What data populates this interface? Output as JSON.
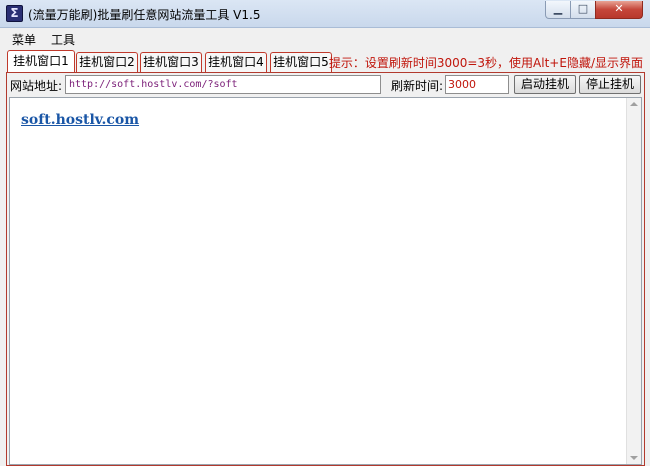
{
  "window": {
    "icon_glyph": "Σ",
    "title": "(流量万能刷)批量刷任意网站流量工具 V1.5",
    "min_glyph": "▁",
    "max_glyph": "□",
    "close_glyph": "✕"
  },
  "menu": [
    "菜单",
    "工具"
  ],
  "tabs": [
    "挂机窗口1",
    "挂机窗口2",
    "挂机窗口3",
    "挂机窗口4",
    "挂机窗口5"
  ],
  "active_tab": 0,
  "hint": "提示：设置刷新时间3000=3秒，使用Alt+E隐藏/显示界面",
  "form": {
    "url_label": "网站地址:",
    "url_value": "http://soft.hostlv.com/?soft",
    "refresh_label": "刷新时间:",
    "refresh_value": "3000",
    "start_button": "启动挂机",
    "stop_button": "停止挂机"
  },
  "browser": {
    "link_text": "soft.hostlv.com"
  },
  "colors": {
    "accent_red": "#c0150b",
    "link_blue": "#1a56a6"
  }
}
